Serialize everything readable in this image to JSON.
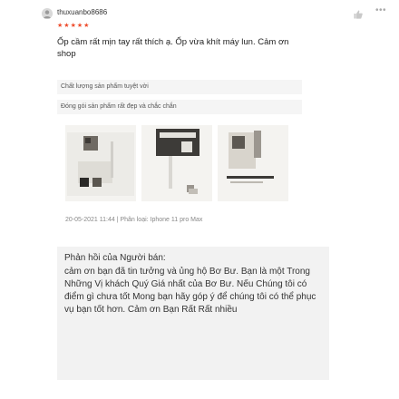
{
  "review": {
    "username": "thuxuanbo8686",
    "rating": 5,
    "comment": "Ốp cầm rất mịn tay rất thích ạ. Ốp vừa khít máy lun. Cảm ơn shop",
    "tags": [
      "Chất lượng sản phẩm tuyệt vời",
      "Đóng gói sản phẩm rất đẹp và chắc chắn"
    ],
    "meta": "20-05-2021 11:44 | Phân loại: Iphone 11 pro Max",
    "icons": {
      "avatar": "user-avatar-icon",
      "like": "thumbs-up-icon",
      "more": "more-dots-icon",
      "star": "star-icon"
    },
    "colors": {
      "star": "#ee4d2d",
      "reply_bg": "#f2f2f2"
    }
  },
  "seller_reply": {
    "title": "Phản hồi của Người bán:",
    "body": "cảm ơn bạn đã tin tưởng và ủng hộ Bơ Bư. Bạn là một Trong Những Vị khách Quý Giá nhất của Bơ Bư. Nếu Chúng tôi có điểm gì chưa tốt Mong bạn hãy góp ý để chúng tôi có thể phục vụ bạn tốt hơn. Cảm ơn Bạn Rất Rất nhiều"
  }
}
